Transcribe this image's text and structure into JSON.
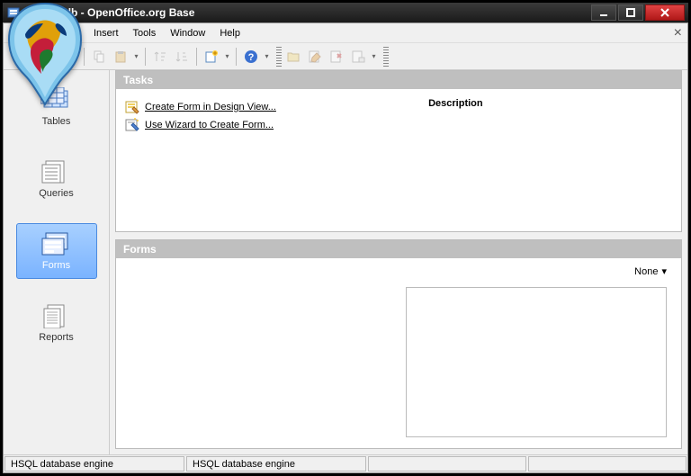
{
  "window": {
    "title": "base4.odb - OpenOffice.org Base"
  },
  "menu": {
    "insert": "Insert",
    "tools": "Tools",
    "window": "Window",
    "help": "Help"
  },
  "sidebar": {
    "tables": "Tables",
    "queries": "Queries",
    "forms": "Forms",
    "reports": "Reports"
  },
  "tasksPanel": {
    "title": "Tasks",
    "createDesign": "Create Form in Design View...",
    "useWizard": "Use Wizard to Create Form...",
    "descriptionLabel": "Description"
  },
  "formsPanel": {
    "title": "Forms",
    "previewMode": "None"
  },
  "status": {
    "left": "HSQL database engine",
    "right": "HSQL database engine"
  }
}
